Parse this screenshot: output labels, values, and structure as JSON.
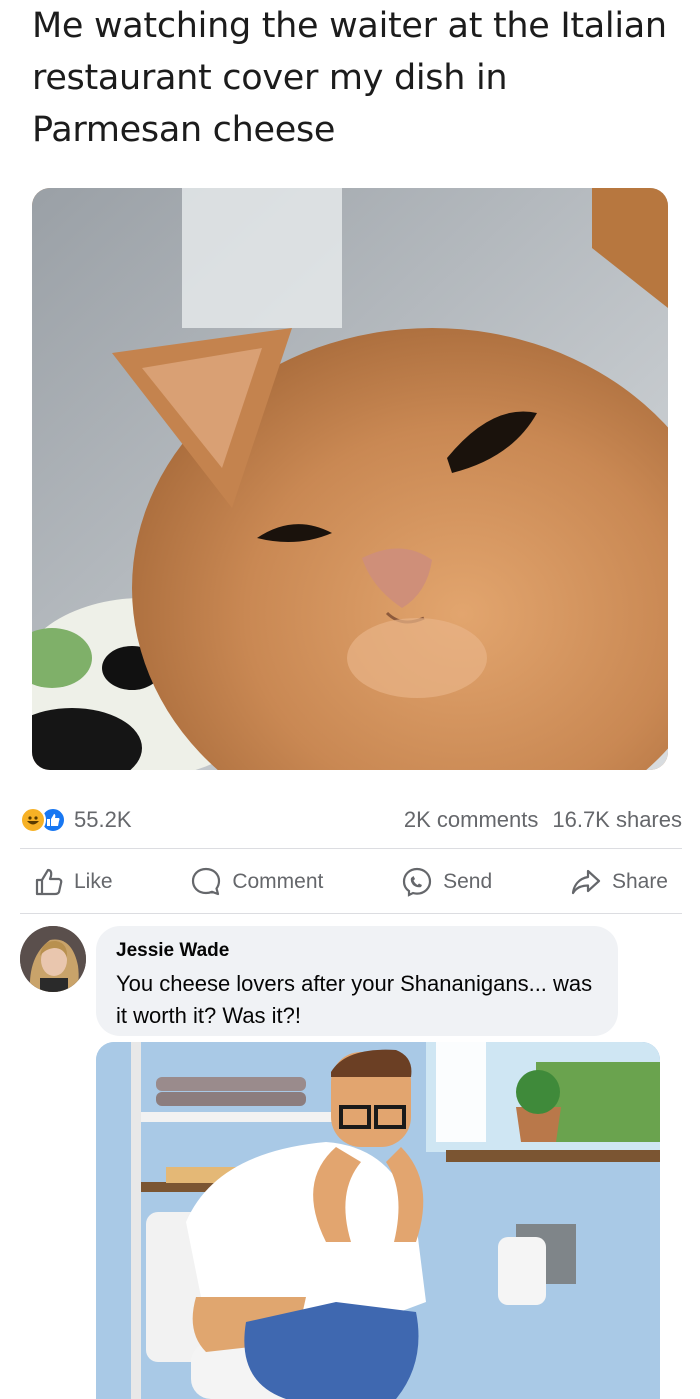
{
  "post": {
    "caption": "Me watching the waiter at the Italian restaurant cover my dish in Parmesan cheese"
  },
  "stats": {
    "reactions_count": "55.2K",
    "comments": "2K comments",
    "shares": "16.7K shares"
  },
  "actions": {
    "like": "Like",
    "comment": "Comment",
    "send": "Send",
    "share": "Share"
  },
  "comment": {
    "author": "Jessie Wade",
    "text": "You cheese lovers after your Shananigans... was it worth it? Was it?!"
  },
  "colors": {
    "accent": "#1877f2",
    "haha": "#f7b125",
    "muted": "#65676b",
    "bubble": "#f0f2f5"
  },
  "icons": [
    "haha-reaction-icon",
    "like-reaction-icon",
    "thumbs-up-icon",
    "comment-icon",
    "messenger-icon",
    "share-arrow-icon"
  ]
}
